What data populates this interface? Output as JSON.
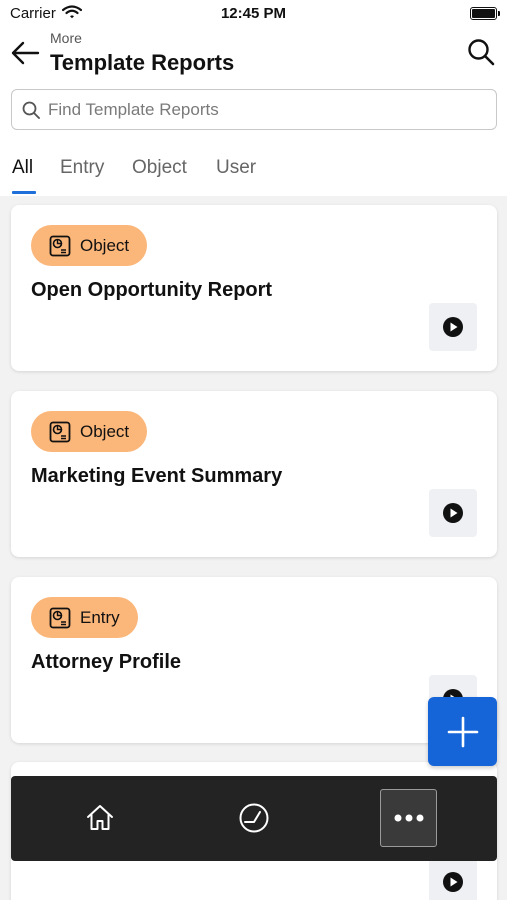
{
  "status_bar": {
    "carrier": "Carrier",
    "time": "12:45 PM"
  },
  "header": {
    "breadcrumb": "More",
    "title": "Template Reports"
  },
  "search": {
    "placeholder": "Find Template Reports"
  },
  "tabs": [
    {
      "label": "All",
      "active": true
    },
    {
      "label": "Entry",
      "active": false
    },
    {
      "label": "Object",
      "active": false
    },
    {
      "label": "User",
      "active": false
    }
  ],
  "reports": [
    {
      "type": "Object",
      "title": "Open Opportunity Report"
    },
    {
      "type": "Object",
      "title": "Marketing Event Summary"
    },
    {
      "type": "Entry",
      "title": "Attorney Profile"
    }
  ],
  "colors": {
    "accent": "#1e6fd9",
    "fab": "#1565d8",
    "badge": "#fbb67a",
    "bottom_bar": "#232323"
  },
  "icons": {
    "back": "arrow-left-icon",
    "search": "search-icon",
    "badge": "report-type-icon",
    "run": "play-icon",
    "fab": "plus-icon",
    "home": "home-icon",
    "dashboard": "gauge-icon",
    "more": "more-dots-icon"
  }
}
